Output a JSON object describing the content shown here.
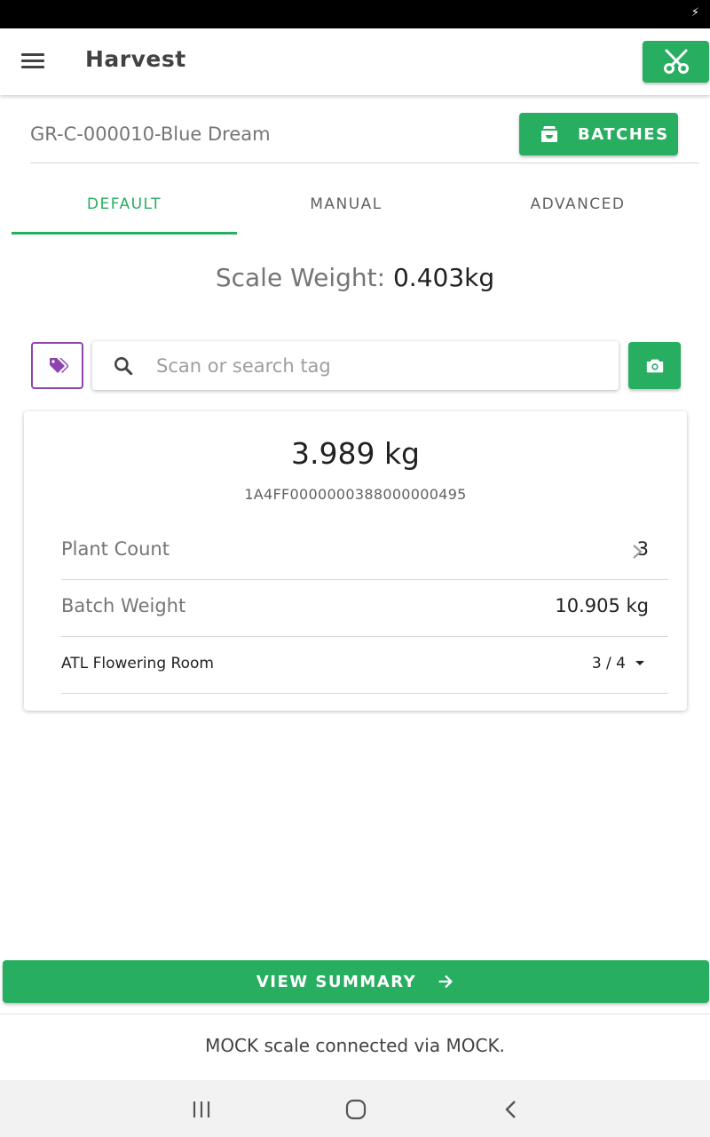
{
  "app": {
    "title": "Harvest",
    "accent_color": "#27ae60",
    "tag_color": "#8e44ad"
  },
  "icons": {
    "menu": "hamburger-menu-icon",
    "harvest_action": "scissors-icon",
    "batches": "archive-tray-icon",
    "tag": "tag-icon",
    "search": "search-icon",
    "camera": "camera-icon",
    "chevron": "chevron-right-icon",
    "dropdown": "caret-down-icon",
    "arrow": "arrow-right-icon",
    "charging": "charging-icon"
  },
  "batch": {
    "name": "GR-C-000010-Blue Dream",
    "batches_label": "BATCHES"
  },
  "tabs": [
    {
      "label": "DEFAULT",
      "active": true
    },
    {
      "label": "MANUAL",
      "active": false
    },
    {
      "label": "ADVANCED",
      "active": false
    }
  ],
  "scale": {
    "label": "Scale Weight:",
    "value": "0.403kg"
  },
  "search": {
    "placeholder": "Scan or search tag",
    "value": ""
  },
  "card": {
    "weight": "3.989 kg",
    "tag_id": "1A4FF0000000388000000495",
    "plant_count_label": "Plant Count",
    "plant_count_value": "3",
    "batch_weight_label": "Batch Weight",
    "batch_weight_value": "10.905 kg",
    "room_label": "ATL Flowering Room",
    "room_value": "3 / 4"
  },
  "summary_button": {
    "label": "VIEW SUMMARY"
  },
  "footer": {
    "status": "MOCK scale connected via MOCK."
  },
  "system_nav": {
    "recents": "recent-apps-icon",
    "home": "home-icon",
    "back": "back-icon"
  }
}
